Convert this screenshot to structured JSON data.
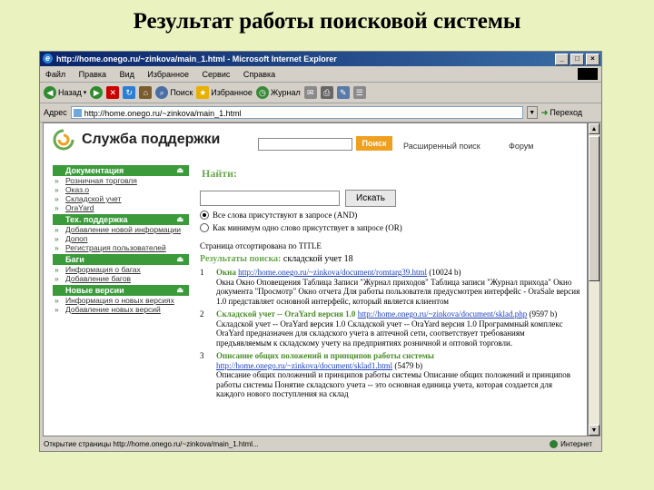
{
  "slide_title": "Результат работы поисковой системы",
  "window": {
    "title": "http://home.onego.ru/~zinkova/main_1.html - Microsoft Internet Explorer"
  },
  "menu": [
    "Файл",
    "Правка",
    "Вид",
    "Избранное",
    "Сервис",
    "Справка"
  ],
  "toolbar": {
    "back": "Назад",
    "search": "Поиск",
    "favorites": "Избранное",
    "media": "Журнал"
  },
  "address": {
    "label": "Адрес",
    "url": "http://home.onego.ru/~zinkova/main_1.html",
    "go": "Переход"
  },
  "site": {
    "logo": "Служба поддержки",
    "search_button": "Поиск",
    "links": [
      "Расширенный поиск",
      "Форум"
    ],
    "sections": [
      {
        "title": "Документация",
        "items": [
          "Розничная торговля",
          "Оказ.о",
          "Складской учет",
          "OraYard"
        ]
      },
      {
        "title": "Тех. поддержка",
        "items": [
          "Добавление новой информации",
          "Допоп",
          "Регистрация пользователей"
        ]
      },
      {
        "title": "Баги",
        "items": [
          "Информация о багах",
          "Добавление багов"
        ]
      },
      {
        "title": "Новые версии",
        "items": [
          "Информация о новых версиях",
          "Добавление новых версий"
        ]
      }
    ]
  },
  "search_page": {
    "heading": "Найти:",
    "submit": "Искать",
    "option_and": "Все слова присутствуют в запросе (AND)",
    "option_or": "Как минимум одно слово присутствует в запросе (OR)",
    "sort_note": "Страница отсортирована по TITLE",
    "results_label": "Результаты поиска:",
    "results_query": "складской учет 18"
  },
  "results": [
    {
      "num": "1",
      "title": "Окна",
      "url": "http://home.onego.ru/~zinkova/document/romtarg39.html",
      "size": "(10024 b)",
      "text": "Окна Окно Оповещения Таблица Записи \"Журнал приходов\" Таблица записи \"Журнал прихода\" Окно документа \"Просмотр\" Окно отчета Для работы пользователя предусмотрен интерфейс - OraSale версия 1.0 представляет основной интерфейс, который является клиентом"
    },
    {
      "num": "2",
      "title": "Складской учет -- OraYard версия 1.0",
      "url": "http://home.onego.ru/~zinkova/document/sklad.php",
      "size": "(9597 b)",
      "text": "Складской учет -- OraYard версия 1.0 Складской учет -- OraYard версия 1.0 Программный комплекс OraYard предназначен для складского учета в аптечной сети, соответствует требованиям предъявляемым к складскому учету на предприятиях розничной и оптовой торговли."
    },
    {
      "num": "3",
      "title": "Описание общих положений и принципов работы системы",
      "url": "http://home.onego.ru/~zinkova/document/sklad1.html",
      "size": "(5479 b)",
      "text": "Описание общих положений и принципов работы системы Описание общих положений и принципов работы системы Понятие складского учета -- это основная единица учета, которая создается для каждого нового поступления на склад"
    }
  ],
  "status": {
    "text": "Открытие страницы http://home.onego.ru/~zinkova/main_1.html...",
    "zone": "Интернет"
  }
}
